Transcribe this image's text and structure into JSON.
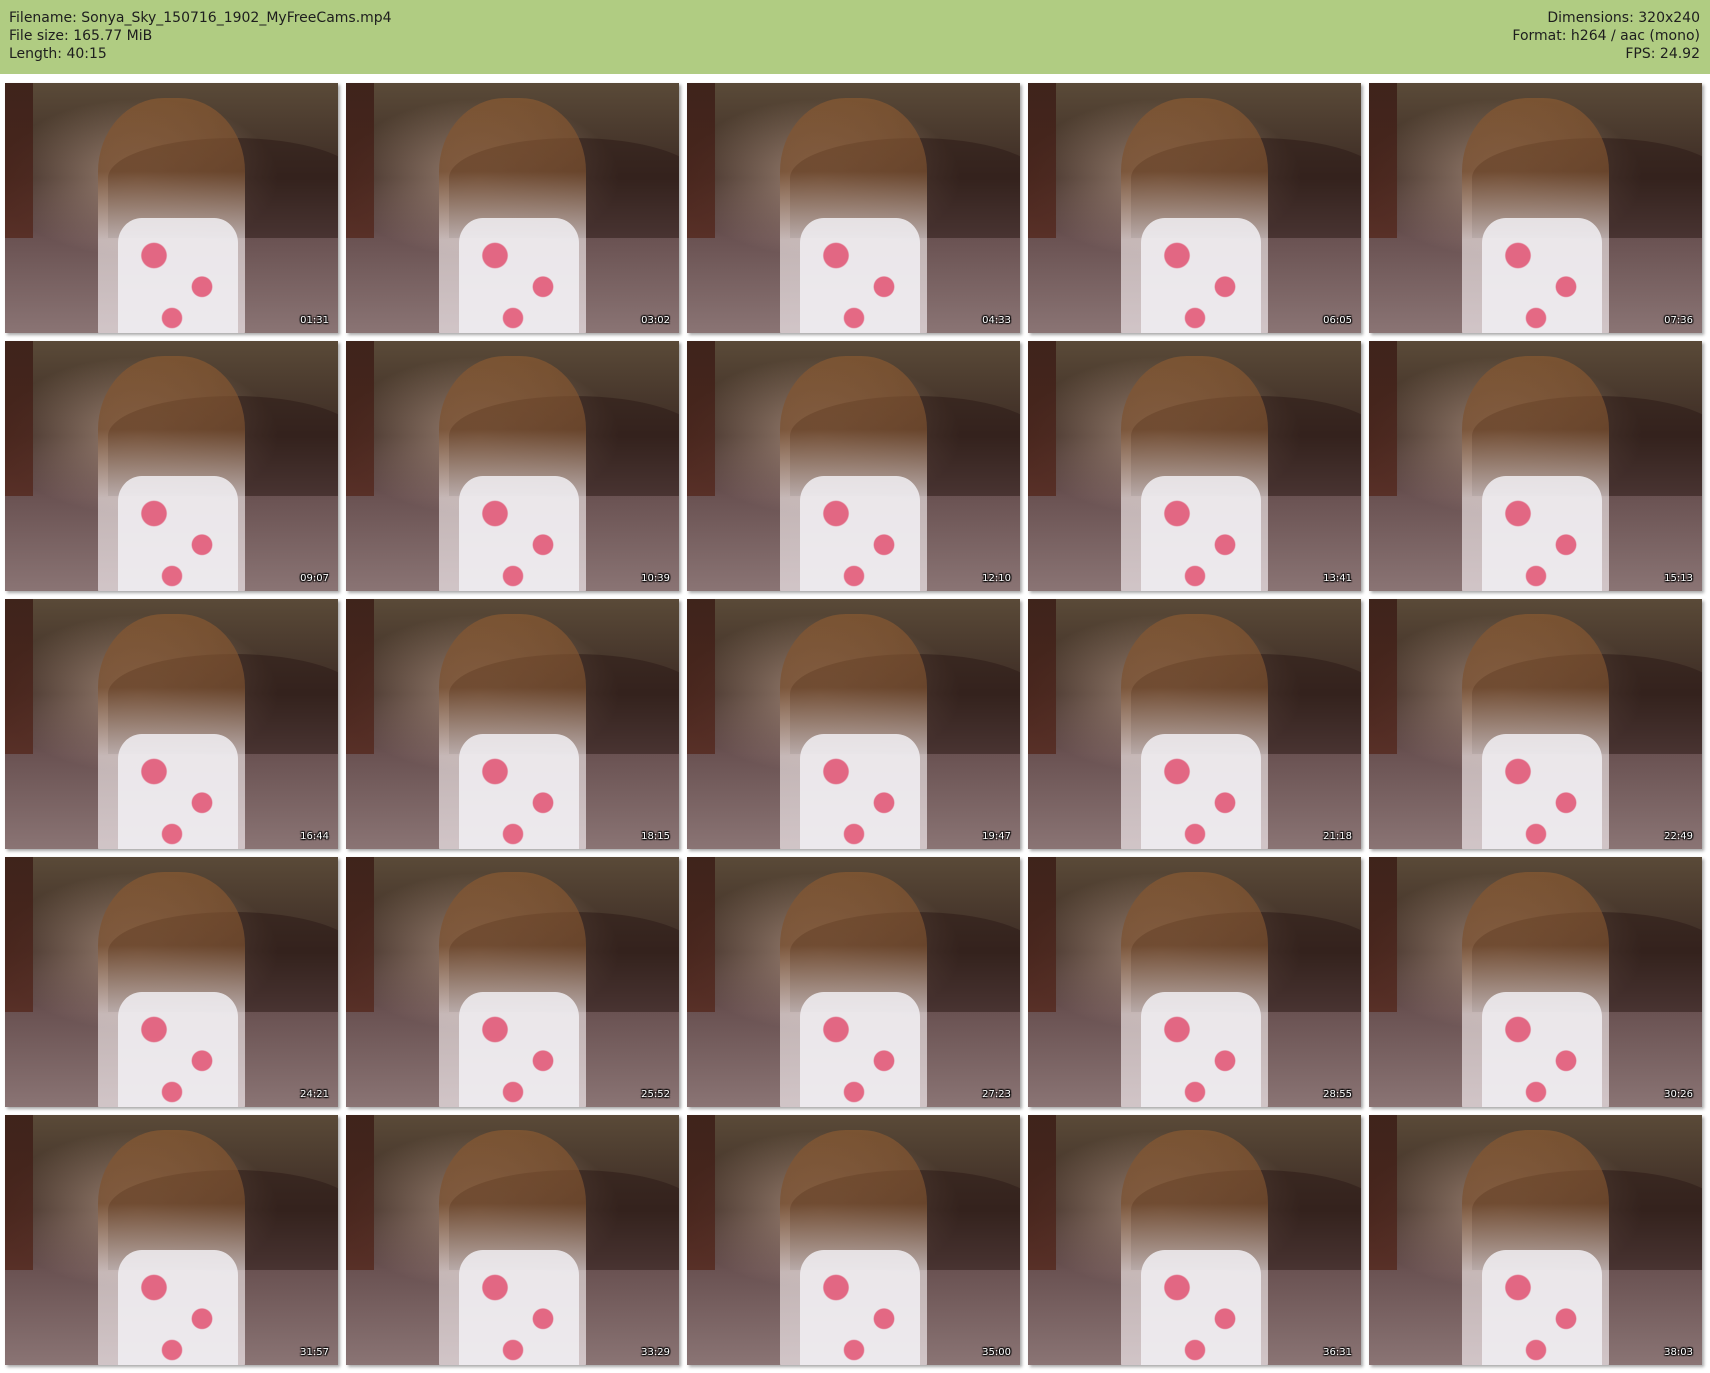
{
  "header": {
    "left": [
      "Filename: Sonya_Sky_150716_1902_MyFreeCams.mp4",
      "File size: 165.77 MiB",
      "Length: 40:15"
    ],
    "right": [
      "Dimensions: 320x240",
      "Format: h264 / aac (mono)",
      "FPS: 24.92"
    ],
    "background_color": "#b0cc82"
  },
  "thumbnails": [
    {
      "timestamp": "01:31"
    },
    {
      "timestamp": "03:02"
    },
    {
      "timestamp": "04:33"
    },
    {
      "timestamp": "06:05"
    },
    {
      "timestamp": "07:36"
    },
    {
      "timestamp": "09:07"
    },
    {
      "timestamp": "10:39"
    },
    {
      "timestamp": "12:10"
    },
    {
      "timestamp": "13:41"
    },
    {
      "timestamp": "15:13"
    },
    {
      "timestamp": "16:44"
    },
    {
      "timestamp": "18:15"
    },
    {
      "timestamp": "19:47"
    },
    {
      "timestamp": "21:18"
    },
    {
      "timestamp": "22:49"
    },
    {
      "timestamp": "24:21"
    },
    {
      "timestamp": "25:52"
    },
    {
      "timestamp": "27:23"
    },
    {
      "timestamp": "28:55"
    },
    {
      "timestamp": "30:26"
    },
    {
      "timestamp": "31:57"
    },
    {
      "timestamp": "33:29"
    },
    {
      "timestamp": "35:00"
    },
    {
      "timestamp": "36:31"
    },
    {
      "timestamp": "38:03"
    }
  ]
}
